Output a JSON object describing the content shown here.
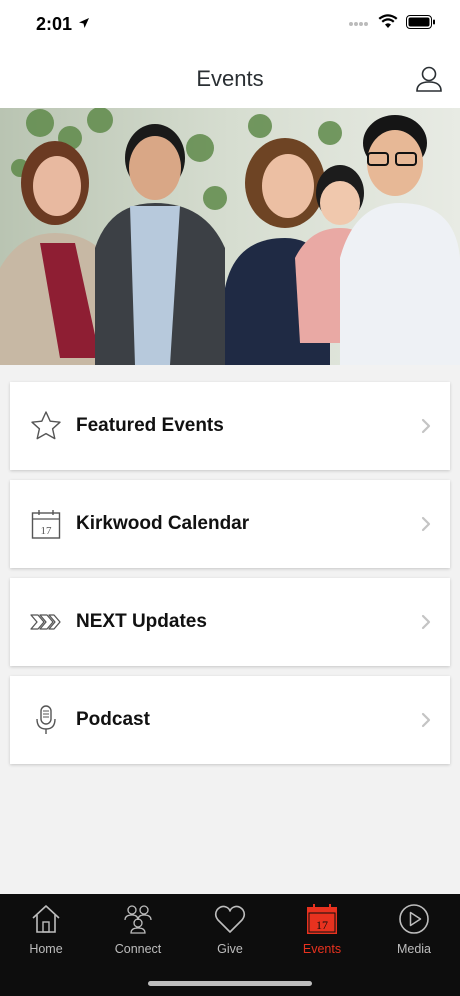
{
  "status": {
    "time": "2:01"
  },
  "header": {
    "title": "Events"
  },
  "menu": {
    "items": [
      {
        "label": "Featured Events",
        "icon": "star-icon"
      },
      {
        "label": "Kirkwood Calendar",
        "icon": "calendar-icon",
        "icon_text": "17"
      },
      {
        "label": "NEXT Updates",
        "icon": "chevrons-icon"
      },
      {
        "label": "Podcast",
        "icon": "microphone-icon"
      }
    ]
  },
  "tabs": {
    "items": [
      {
        "label": "Home",
        "icon": "home-icon"
      },
      {
        "label": "Connect",
        "icon": "people-icon"
      },
      {
        "label": "Give",
        "icon": "heart-icon"
      },
      {
        "label": "Events",
        "icon": "calendar-icon",
        "icon_text": "17",
        "active": true
      },
      {
        "label": "Media",
        "icon": "play-icon"
      }
    ]
  },
  "colors": {
    "active_tab": "#e8321f",
    "tab_bar_bg": "#0d0d0d"
  }
}
